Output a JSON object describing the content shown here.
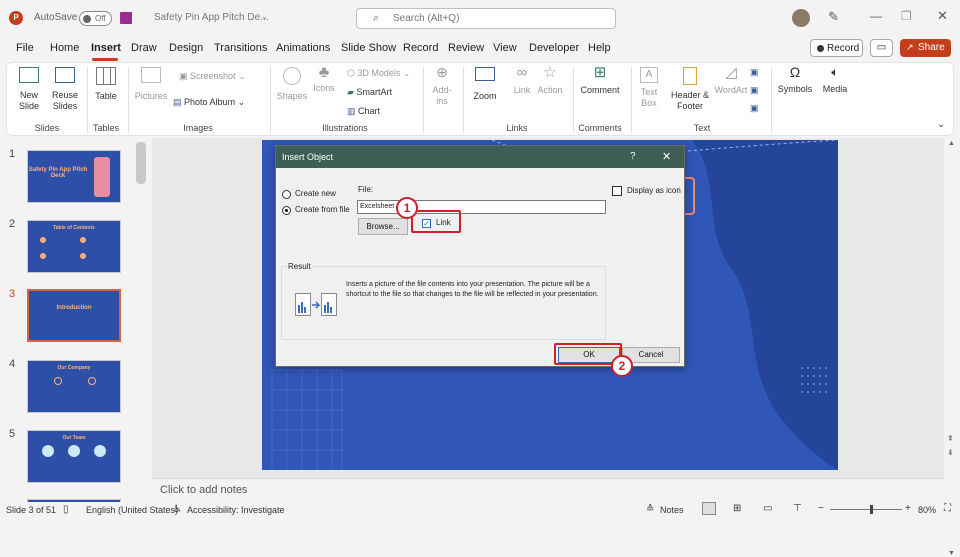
{
  "titlebar": {
    "autosave_label": "AutoSave",
    "autosave_state": "Off",
    "file_name": "Safety Pin App Pitch De...",
    "search_placeholder": "Search (Alt+Q)"
  },
  "menu": {
    "items": [
      "File",
      "Home",
      "Insert",
      "Draw",
      "Design",
      "Transitions",
      "Animations",
      "Slide Show",
      "Record",
      "Review",
      "View",
      "Developer",
      "Help"
    ],
    "active": "Insert",
    "record_button": "Record",
    "share_button": "Share"
  },
  "ribbon": {
    "new_slide": "New Slide",
    "reuse_slides": "Reuse Slides",
    "table": "Table",
    "pictures": "Pictures",
    "screenshot": "Screenshot",
    "photo_album": "Photo Album",
    "shapes": "Shapes",
    "icons": "Icons",
    "models_3d": "3D Models",
    "smartart": "SmartArt",
    "chart": "Chart",
    "addins": "Add-ins",
    "zoom": "Zoom",
    "link": "Link",
    "action": "Action",
    "comment": "Comment",
    "text_box": "Text Box",
    "header_footer": "Header & Footer",
    "wordart": "WordArt",
    "symbols": "Symbols",
    "media": "Media",
    "groups": {
      "slides": "Slides",
      "tables": "Tables",
      "images": "Images",
      "illustrations": "Illustrations",
      "links": "Links",
      "comments": "Comments",
      "text": "Text"
    }
  },
  "thumbnails": [
    {
      "num": "1",
      "title": "Safety Pin App Pitch Deck"
    },
    {
      "num": "2",
      "title": "Table of Contents"
    },
    {
      "num": "3",
      "title": "Introduction"
    },
    {
      "num": "4",
      "title": "Our Company"
    },
    {
      "num": "5",
      "title": "Our Team"
    }
  ],
  "dialog": {
    "title": "Insert Object",
    "help": "?",
    "close": "✕",
    "create_new": "Create new",
    "create_from_file": "Create from file",
    "file_label": "File:",
    "file_value": "Excelsheet",
    "browse": "Browse...",
    "link_label": "Link",
    "display_as_icon": "Display as icon",
    "result_label": "Result",
    "result_text": "Inserts a picture of the file contents into your presentation. The picture will be a shortcut to the file so that changes to the file will be reflected in your presentation.",
    "ok": "OK",
    "cancel": "Cancel"
  },
  "annotations": {
    "step1": "1",
    "step2": "2"
  },
  "notes_placeholder": "Click to add notes",
  "status": {
    "slide_info": "Slide 3 of 51",
    "language": "English (United States)",
    "accessibility": "Accessibility: Investigate",
    "notes": "Notes",
    "zoom": "80%"
  },
  "colors": {
    "accent": "#c43e1c",
    "slide_bg": "#3057b8",
    "dialog_title": "#3e5f55",
    "annotation": "#c9222b"
  }
}
